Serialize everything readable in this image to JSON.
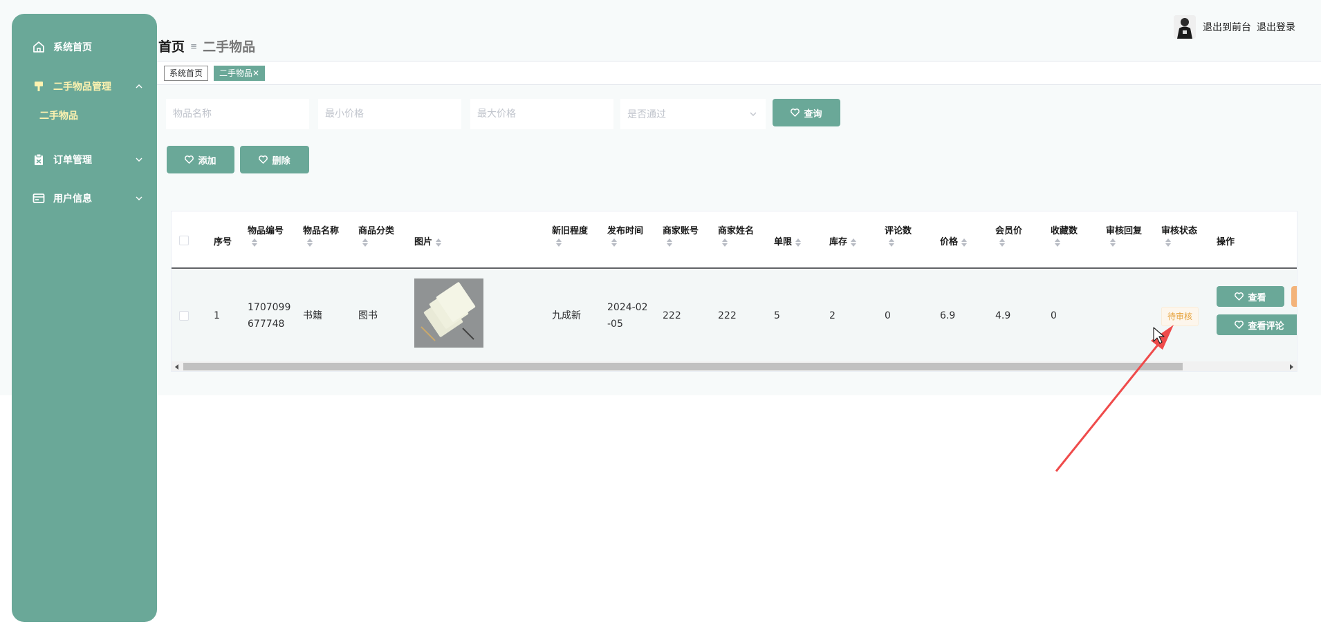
{
  "sidebar": {
    "items": [
      {
        "label": "系统首页",
        "icon": "home-icon"
      },
      {
        "label": "二手物品管理",
        "icon": "brush-icon",
        "expanded": true
      },
      {
        "label": "订单管理",
        "icon": "clipboard-icon"
      },
      {
        "label": "用户信息",
        "icon": "id-card-icon"
      }
    ],
    "sub_item": "二手物品"
  },
  "header": {
    "breadcrumb_home": "首页",
    "breadcrumb_separator": "≡",
    "breadcrumb_current": "二手物品",
    "link_front": "退出到前台",
    "link_logout": "退出登录"
  },
  "tabs": [
    {
      "label": "系统首页",
      "active": false
    },
    {
      "label": "二手物品✕",
      "active": true
    }
  ],
  "search": {
    "name_placeholder": "物品名称",
    "min_price_placeholder": "最小价格",
    "max_price_placeholder": "最大价格",
    "approval_placeholder": "是否通过",
    "query_label": "查询"
  },
  "actions": {
    "add_label": "添加",
    "delete_label": "删除"
  },
  "table": {
    "headers": {
      "index": "序号",
      "item_no": "物品编号",
      "item_name": "物品名称",
      "category": "商品分类",
      "image": "图片",
      "condition": "新旧程度",
      "publish_time": "发布时间",
      "merchant_account": "商家账号",
      "merchant_name": "商家姓名",
      "limit": "单限",
      "stock": "库存",
      "comments": "评论数",
      "price": "价格",
      "member_price": "会员价",
      "favorites": "收藏数",
      "review_reply": "审核回复",
      "review_status": "审核状态",
      "operation": "操作"
    },
    "row": {
      "index": "1",
      "item_no_line1": "1707099",
      "item_no_line2": "677748",
      "item_name": "书籍",
      "category": "图书",
      "condition": "九成新",
      "publish_time_line1": "2024-02",
      "publish_time_line2": "-05",
      "merchant_account": "222",
      "merchant_name": "222",
      "limit": "5",
      "stock": "2",
      "comments": "0",
      "price": "6.9",
      "member_price": "4.9",
      "favorites": "0",
      "review_reply": "",
      "review_status": "待审核",
      "view_label": "查看",
      "view_comments_label": "查看评论"
    }
  },
  "colors": {
    "primary": "#6aa898",
    "highlight_text": "#fff3b0",
    "pending_badge_text": "#e6a23c",
    "annotation_arrow": "#ef4b4b"
  }
}
